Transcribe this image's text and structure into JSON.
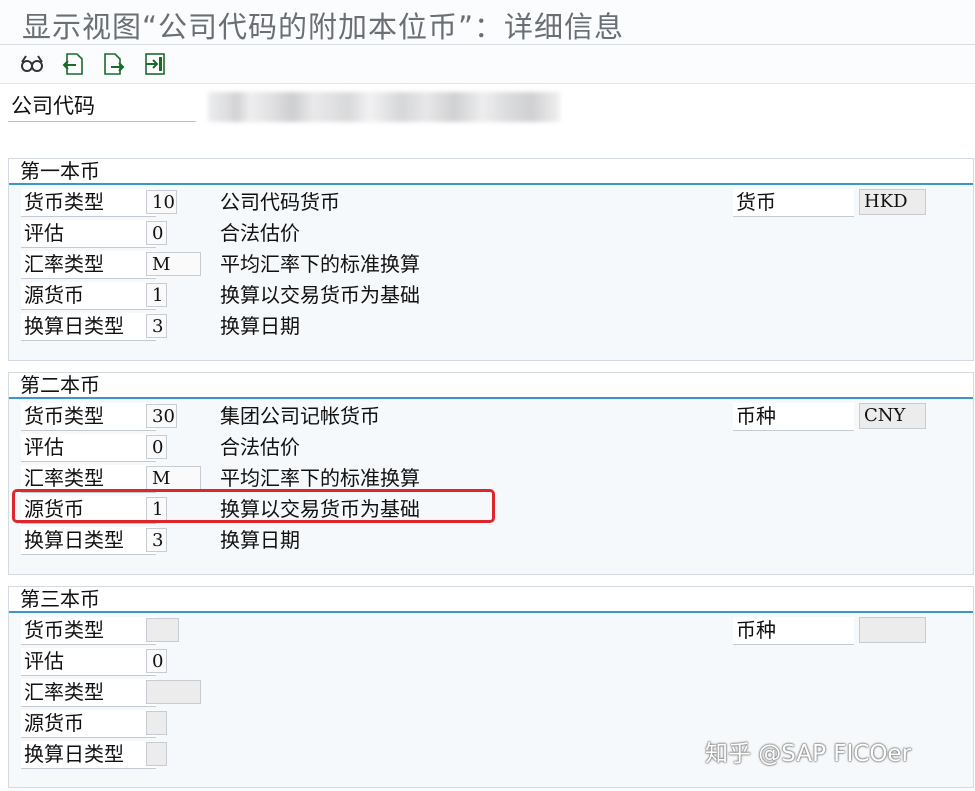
{
  "window": {
    "title": "显示视图“公司代码的附加本位币”：详细信息"
  },
  "toolbar": {
    "buttons": [
      "glasses-icon",
      "back-doc-icon",
      "forward-doc-icon",
      "exit-doc-icon"
    ]
  },
  "company_code": {
    "label": "公司代码",
    "value": ""
  },
  "groups": [
    {
      "title": "第一本币",
      "fields": [
        {
          "label": "货币类型",
          "value": "10",
          "desc": "公司代码货币"
        },
        {
          "label": "评估",
          "value": "0",
          "desc": "合法估价"
        },
        {
          "label": "汇率类型",
          "value": "M",
          "desc": "平均汇率下的标准换算"
        },
        {
          "label": "源货币",
          "value": "1",
          "desc": "换算以交易货币为基础"
        },
        {
          "label": "换算日类型",
          "value": "3",
          "desc": "换算日期"
        }
      ],
      "currency": {
        "label": "货币",
        "value": "HKD"
      }
    },
    {
      "title": "第二本币",
      "fields": [
        {
          "label": "货币类型",
          "value": "30",
          "desc": "集团公司记帐货币"
        },
        {
          "label": "评估",
          "value": "0",
          "desc": "合法估价"
        },
        {
          "label": "汇率类型",
          "value": "M",
          "desc": "平均汇率下的标准换算"
        },
        {
          "label": "源货币",
          "value": "1",
          "desc": "换算以交易货币为基础"
        },
        {
          "label": "换算日类型",
          "value": "3",
          "desc": "换算日期"
        }
      ],
      "currency": {
        "label": "币种",
        "value": "CNY"
      }
    },
    {
      "title": "第三本币",
      "fields": [
        {
          "label": "货币类型",
          "value": "",
          "desc": ""
        },
        {
          "label": "评估",
          "value": "0",
          "desc": ""
        },
        {
          "label": "汇率类型",
          "value": "",
          "desc": ""
        },
        {
          "label": "源货币",
          "value": "",
          "desc": ""
        },
        {
          "label": "换算日类型",
          "value": "",
          "desc": ""
        }
      ],
      "currency": {
        "label": "币种",
        "value": ""
      }
    }
  ],
  "watermark": "知乎 @SAP FICOer",
  "colors": {
    "highlight": "#e0262d",
    "group_rule": "#3b97c7"
  }
}
